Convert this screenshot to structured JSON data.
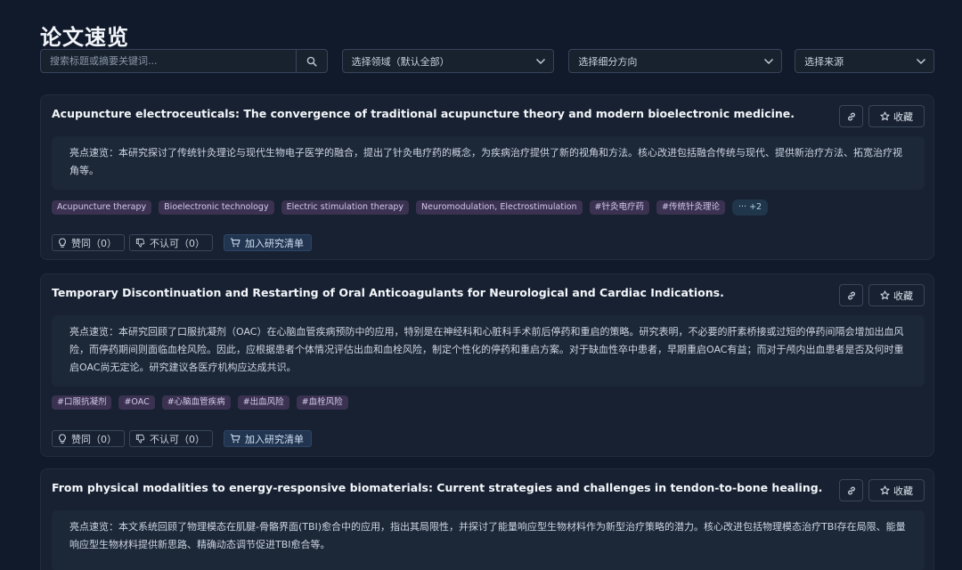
{
  "page": {
    "title": "论文速览"
  },
  "filters": {
    "search_placeholder": "搜索标题或摘要关键词...",
    "field_select": "选择领域（默认全部）",
    "direction_select": "选择细分方向",
    "source_select": "选择来源"
  },
  "icons": {
    "search": "search-icon",
    "chevron": "chevron-down-icon",
    "link": "link-icon",
    "star": "star-icon",
    "bulb": "lightbulb-icon",
    "thumb_down": "thumbs-down-icon",
    "cart": "cart-icon"
  },
  "papers": [
    {
      "title": "Acupuncture electroceuticals: The convergence of traditional acupuncture theory and modern bioelectronic medicine.",
      "favorite_label": "收藏",
      "summary": "亮点速览：本研究探讨了传统针灸理论与现代生物电子医学的融合，提出了针灸电疗药的概念，为疾病治疗提供了新的视角和方法。核心改进包括融合传统与现代、提供新治疗方法、拓宽治疗视角等。",
      "tags": [
        "Acupuncture therapy",
        "Bioelectronic technology",
        "Electric stimulation therapy",
        "Neuromodulation, Electrostimulation",
        "#针灸电疗药",
        "#传统针灸理论"
      ],
      "more_tags": "··· +2",
      "like_label": "赞同（0）",
      "dislike_label": "不认可（0）",
      "add_label": "加入研究清单"
    },
    {
      "title": "Temporary Discontinuation and Restarting of Oral Anticoagulants for Neurological and Cardiac Indications.",
      "favorite_label": "收藏",
      "summary": "亮点速览：本研究回顾了口服抗凝剂（OAC）在心脑血管疾病预防中的应用，特别是在神经科和心脏科手术前后停药和重启的策略。研究表明，不必要的肝素桥接或过短的停药间隔会增加出血风险，而停药期间则面临血栓风险。因此，应根据患者个体情况评估出血和血栓风险，制定个性化的停药和重启方案。对于缺血性卒中患者，早期重启OAC有益；而对于颅内出血患者是否及何时重启OAC尚无定论。研究建议各医疗机构应达成共识。",
      "tags": [
        "#口服抗凝剂",
        "#OAC",
        "#心脑血管疾病",
        "#出血风险",
        "#血栓风险"
      ],
      "like_label": "赞同（0）",
      "dislike_label": "不认可（0）",
      "add_label": "加入研究清单"
    },
    {
      "title": "From physical modalities to energy-responsive biomaterials: Current strategies and challenges in tendon-to-bone healing.",
      "favorite_label": "收藏",
      "summary": "亮点速览：本文系统回顾了物理模态在肌腱-骨骼界面(TBI)愈合中的应用，指出其局限性，并探讨了能量响应型生物材料作为新型治疗策略的潜力。核心改进包括物理模态治疗TBI存在局限、能量响应型生物材料提供新思路、精确动态调节促进TBI愈合等。"
    }
  ]
}
